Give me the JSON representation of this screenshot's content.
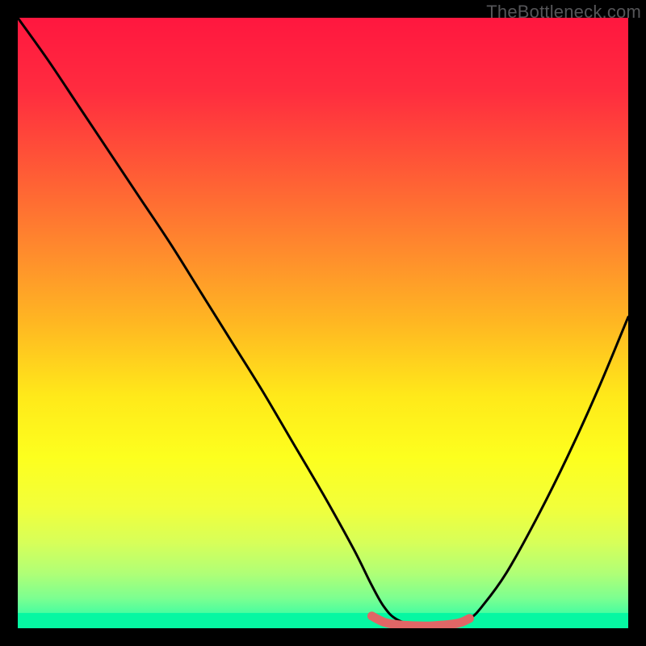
{
  "watermark": "TheBottleneck.com",
  "chart_data": {
    "type": "line",
    "title": "",
    "xlabel": "",
    "ylabel": "",
    "xlim": [
      0,
      100
    ],
    "ylim": [
      0,
      100
    ],
    "series": [
      {
        "name": "black-curve",
        "x": [
          0,
          5,
          10,
          15,
          20,
          25,
          30,
          35,
          40,
          45,
          50,
          55,
          58,
          60,
          62,
          65,
          68,
          72,
          74,
          76,
          80,
          85,
          90,
          95,
          100
        ],
        "y": [
          100,
          93,
          85.5,
          78,
          70.5,
          63,
          55,
          47,
          39,
          30.5,
          22,
          13,
          7,
          3.5,
          1.5,
          0.5,
          0.2,
          0.5,
          1.5,
          3.5,
          9,
          18,
          28,
          39,
          51
        ]
      },
      {
        "name": "red-floor-segment",
        "x": [
          58,
          60,
          62,
          65,
          68,
          72,
          74
        ],
        "y": [
          2.0,
          1.0,
          0.6,
          0.4,
          0.4,
          0.8,
          1.6
        ]
      }
    ],
    "gradient_stops": [
      {
        "offset": 0.0,
        "color": "#ff173f"
      },
      {
        "offset": 0.12,
        "color": "#ff2c3f"
      },
      {
        "offset": 0.25,
        "color": "#ff5a36"
      },
      {
        "offset": 0.38,
        "color": "#ff8a2d"
      },
      {
        "offset": 0.5,
        "color": "#ffb722"
      },
      {
        "offset": 0.62,
        "color": "#ffe91a"
      },
      {
        "offset": 0.72,
        "color": "#fdff1e"
      },
      {
        "offset": 0.8,
        "color": "#f2ff3a"
      },
      {
        "offset": 0.86,
        "color": "#d7ff59"
      },
      {
        "offset": 0.91,
        "color": "#b0ff76"
      },
      {
        "offset": 0.95,
        "color": "#7dff90"
      },
      {
        "offset": 0.975,
        "color": "#49fe9f"
      },
      {
        "offset": 1.0,
        "color": "#06f7a2"
      }
    ],
    "green_band": {
      "y0": 0.0,
      "y1": 2.5
    }
  }
}
